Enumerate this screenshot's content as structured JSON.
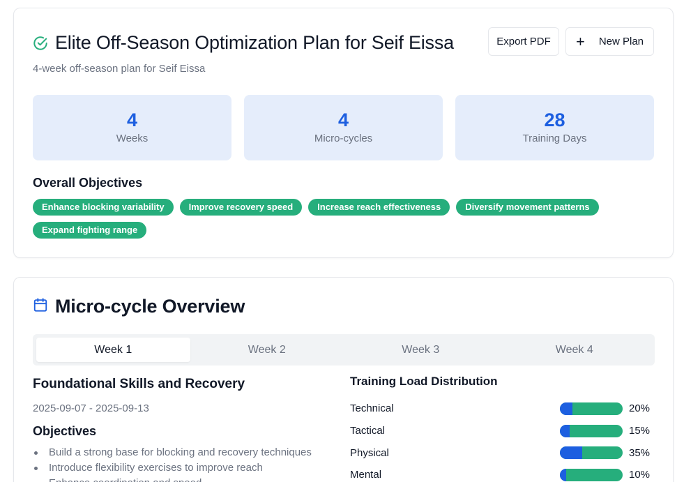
{
  "plan": {
    "title": "Elite Off-Season Optimization Plan for Seif Eissa",
    "subtitle": "4-week off-season plan for Seif Eissa",
    "actions": {
      "export_label": "Export PDF",
      "new_plan_label": "New Plan"
    },
    "stats": [
      {
        "value": "4",
        "label": "Weeks"
      },
      {
        "value": "4",
        "label": "Micro-cycles"
      },
      {
        "value": "28",
        "label": "Training Days"
      }
    ],
    "objectives_heading": "Overall Objectives",
    "objectives": [
      "Enhance blocking variability",
      "Improve recovery speed",
      "Increase reach effectiveness",
      "Diversify movement patterns",
      "Expand fighting range"
    ]
  },
  "micro": {
    "title": "Micro-cycle Overview",
    "tabs": [
      "Week 1",
      "Week 2",
      "Week 3",
      "Week 4"
    ],
    "active_tab": 0,
    "week": {
      "title": "Foundational Skills and Recovery",
      "dates": "2025-09-07 - 2025-09-13",
      "objectives_heading": "Objectives",
      "objectives": [
        "Build a strong base for blocking and recovery techniques",
        "Introduce flexibility exercises to improve reach",
        "Enhance coordination and speed"
      ]
    },
    "load": {
      "heading": "Training Load Distribution",
      "items": [
        {
          "name": "Technical",
          "percent_label": "20%",
          "percent": 20
        },
        {
          "name": "Tactical",
          "percent_label": "15%",
          "percent": 15
        },
        {
          "name": "Physical",
          "percent_label": "35%",
          "percent": 35
        },
        {
          "name": "Mental",
          "percent_label": "10%",
          "percent": 10
        }
      ]
    }
  },
  "colors": {
    "accent_blue": "#1d5fe0",
    "accent_green": "#26ae7c",
    "stat_bg": "#e5edfb"
  },
  "icons": {
    "title_icon": "check-circle-icon",
    "micro_icon": "calendar-icon",
    "new_plan_icon": "plus-icon"
  }
}
